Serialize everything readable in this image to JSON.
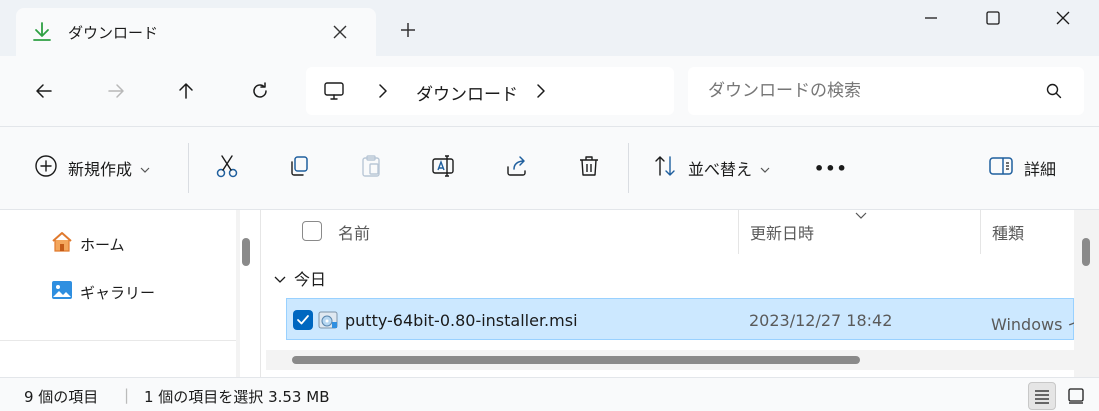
{
  "tab": {
    "title": "ダウンロード",
    "icon": "download-icon",
    "accent": "#2ea043"
  },
  "window_controls": [
    "minimize-icon",
    "maximize-icon",
    "close-icon"
  ],
  "address": {
    "root_icon": "this-pc-icon",
    "current": "ダウンロード"
  },
  "search": {
    "placeholder": "ダウンロードの検索"
  },
  "toolbar": {
    "new_label": "新規作成",
    "sort_label": "並べ替え",
    "details_label": "詳細",
    "more_label": "•••"
  },
  "navpane": {
    "items": [
      {
        "label": "ホーム",
        "icon": "home-icon"
      },
      {
        "label": "ギャラリー",
        "icon": "gallery-icon"
      }
    ]
  },
  "columns": {
    "name": "名前",
    "date": "更新日時",
    "type": "種類"
  },
  "group": {
    "label": "今日"
  },
  "files": [
    {
      "name": "putty-64bit-0.80-installer.msi",
      "date": "2023/12/27 18:42",
      "type": "Windows インストーラー パッケージ",
      "selected": true
    }
  ],
  "status": {
    "count": "9 個の項目",
    "selection": "1 個の項目を選択  3.53 MB"
  },
  "colors": {
    "selection_bg": "#cce8ff",
    "selection_border": "#99d1ff",
    "checkbox": "#0067c0"
  }
}
